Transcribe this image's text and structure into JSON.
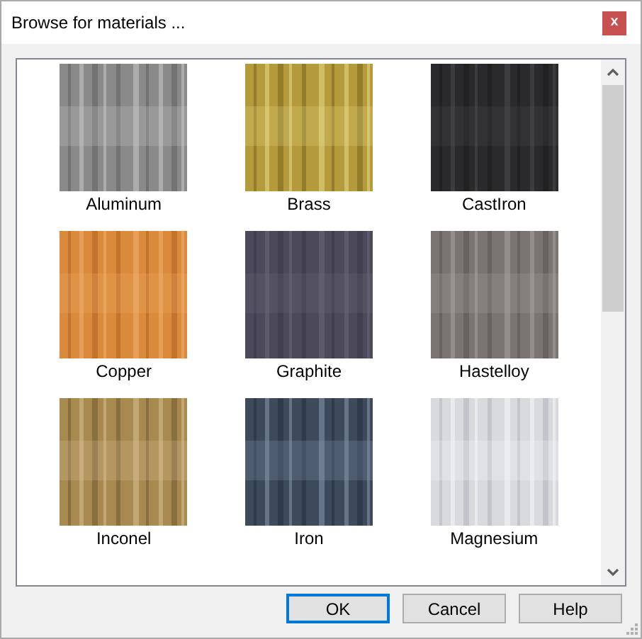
{
  "window": {
    "title": "Browse for materials ...",
    "close": "x"
  },
  "materials": [
    {
      "name": "Aluminum",
      "kind": "picture"
    },
    {
      "name": "Brass",
      "kind": "picture"
    },
    {
      "name": "CastIron",
      "kind": "picture"
    },
    {
      "name": "Copper",
      "kind": "picture"
    },
    {
      "name": "Graphite",
      "kind": "picture"
    },
    {
      "name": "Hastelloy",
      "kind": "picture"
    },
    {
      "name": "Inconel",
      "kind": "picture"
    },
    {
      "name": "Iron",
      "kind": "picture"
    },
    {
      "name": "Magnesium",
      "kind": "picture"
    }
  ],
  "buttons": [
    {
      "label": "OK",
      "default": true
    },
    {
      "label": "Cancel",
      "default": false
    },
    {
      "label": "Help",
      "default": false
    }
  ]
}
